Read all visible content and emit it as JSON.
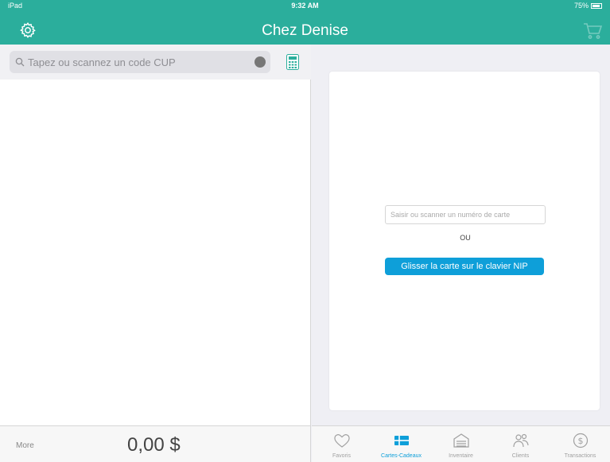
{
  "status_bar": {
    "carrier": "iPad",
    "time": "9:32 AM",
    "battery": "75%"
  },
  "header": {
    "title": "Chez Denise",
    "settings_icon": "gear-icon",
    "cart_icon": "cart-icon"
  },
  "search": {
    "placeholder": "Tapez ou scannez un code CUP"
  },
  "footer": {
    "more_label": "More",
    "total": "0,00 $"
  },
  "gift_card": {
    "input_placeholder": "Saisir ou scanner un numéro de carte",
    "or_label": "OU",
    "swipe_button": "Glisser la carte sur le clavier NIP"
  },
  "tabs": [
    {
      "label": "Favoris",
      "icon": "heart-icon"
    },
    {
      "label": "Cartes-Cadeaux",
      "icon": "gift-card-icon",
      "active": true
    },
    {
      "label": "Inventaire",
      "icon": "inventory-icon"
    },
    {
      "label": "Clients",
      "icon": "clients-icon"
    },
    {
      "label": "Transactions",
      "icon": "dollar-icon"
    }
  ],
  "colors": {
    "header": "#2bae9c",
    "accent": "#0e9fd9"
  }
}
